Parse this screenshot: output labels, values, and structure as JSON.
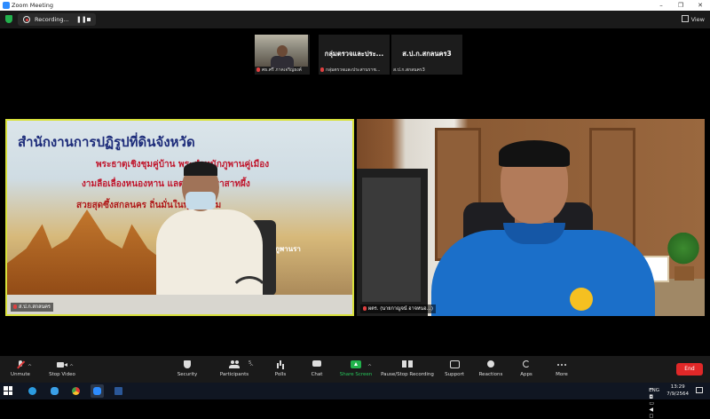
{
  "window": {
    "title": "Zoom Meeting",
    "controls": [
      "–",
      "❐",
      "✕"
    ]
  },
  "topbar": {
    "recording_label": "Recording...",
    "pause_glyph": "❚❚",
    "view_label": "View"
  },
  "thumbnails": [
    {
      "label": "ศธ.ศรี ภาคเจริญยงค์",
      "has_video": true
    },
    {
      "display_name": "กลุ่มตรวจและประ...",
      "label": "กลุ่มตรวจและประสานราช..."
    },
    {
      "display_name": "ส.ป.ก.สกลนคร3",
      "label": "ส.ป.ก.สกลนคร3"
    }
  ],
  "tiles": {
    "left": {
      "label": "ส.ป.ก.สกลนคร",
      "banner_title": "สำนักงานการปฏิรูปที่ดินจังหวัด",
      "banner_lines": [
        "พระธาตุเชิงชุมคู่บ้าน  พระตำหนักภูพานคู่เมือง",
        "งามลือเลื่องหนองหาน แลตระการปราสาทผึ้ง",
        "สวยสุดซึ้งสกลนคร ถิ่นมั่นในพุทธธรรม"
      ],
      "side_text": "หนักภูพานรา"
    },
    "right": {
      "label": "ผตร. (นายกาญจน์ อาจหนอ...)"
    }
  },
  "toolbar": {
    "items": [
      {
        "label": "Unmute",
        "icon": "mic-muted-icon"
      },
      {
        "label": "Stop Video",
        "icon": "video-camera-icon"
      },
      {
        "label": "Security",
        "icon": "shield-icon"
      },
      {
        "label": "Participants",
        "icon": "participants-icon",
        "count": "5"
      },
      {
        "label": "Polls",
        "icon": "polls-icon"
      },
      {
        "label": "Chat",
        "icon": "chat-icon"
      },
      {
        "label": "Share Screen",
        "icon": "share-screen-icon"
      },
      {
        "label": "Pause/Stop Recording",
        "icon": "pause-stop-recording-icon"
      },
      {
        "label": "Support",
        "icon": "support-icon"
      },
      {
        "label": "Reactions",
        "icon": "reactions-icon"
      },
      {
        "label": "Apps",
        "icon": "apps-icon"
      },
      {
        "label": "More",
        "icon": "more-icon"
      }
    ],
    "end_label": "End",
    "colors": {
      "share_green": "#22b24c",
      "end_red": "#e02828",
      "active_speaker": "#d8e13b"
    }
  },
  "taskbar": {
    "apps": [
      "windows-start-icon",
      "edge-icon",
      "ie-icon",
      "chrome-icon",
      "zoom-icon",
      "word-icon"
    ],
    "language": "ENG",
    "time": "13:29",
    "date": "7/9/2564"
  }
}
